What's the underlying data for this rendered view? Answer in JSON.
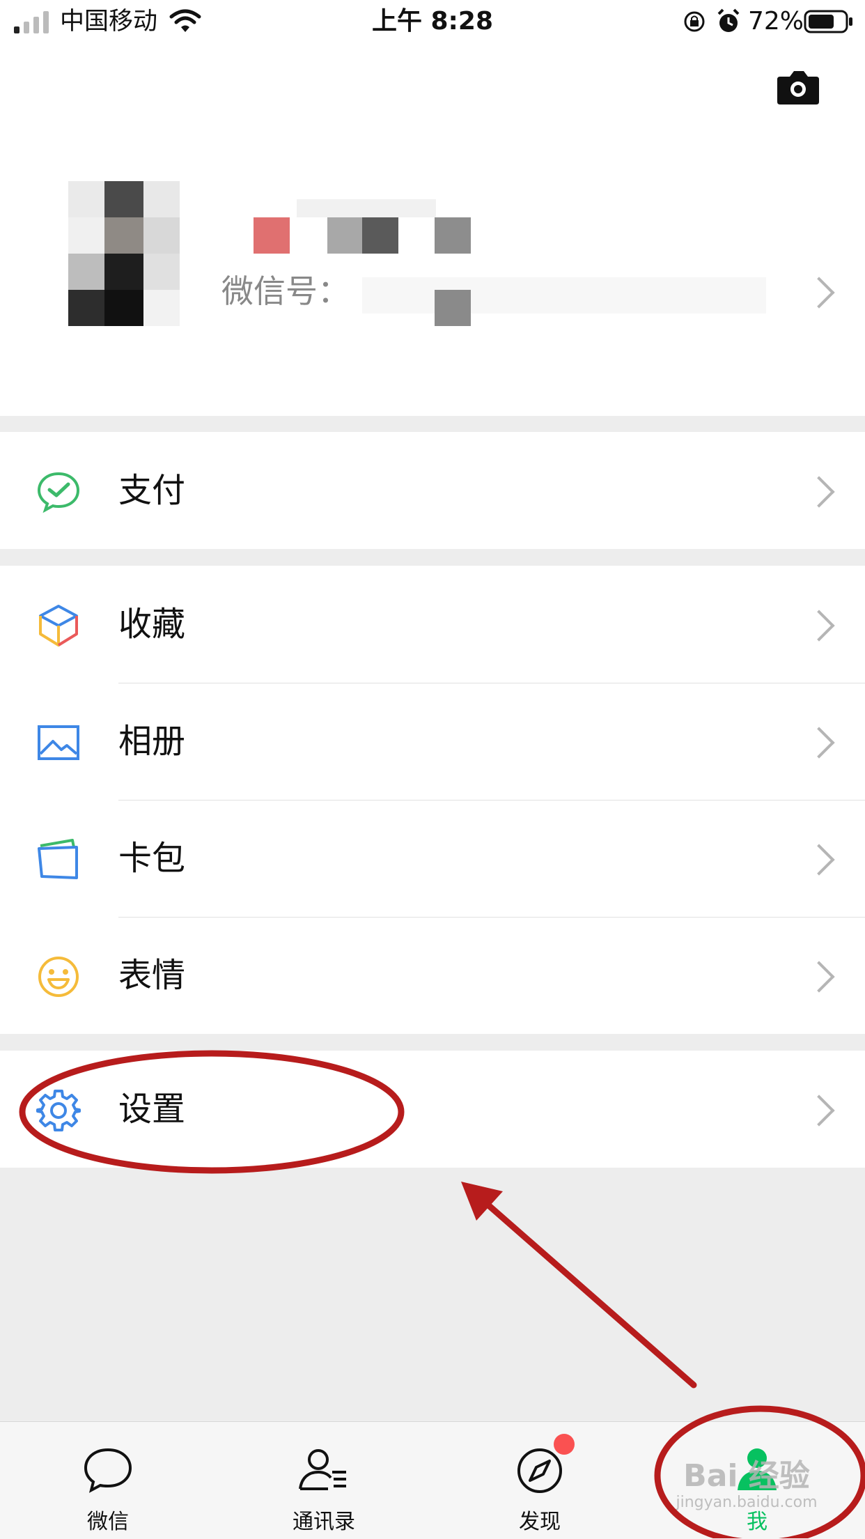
{
  "status_bar": {
    "carrier": "中国移动",
    "time": "上午 8:28",
    "battery": "72%"
  },
  "header": {
    "camera_icon": "camera-icon",
    "wechat_id_label": "微信号："
  },
  "menu": {
    "pay": "支付",
    "favorites": "收藏",
    "album": "相册",
    "cards": "卡包",
    "stickers": "表情",
    "settings": "设置"
  },
  "tabbar": {
    "tabs": [
      {
        "label": "微信",
        "icon": "chat-icon"
      },
      {
        "label": "通讯录",
        "icon": "contacts-icon"
      },
      {
        "label": "发现",
        "icon": "compass-icon"
      },
      {
        "label": "我",
        "icon": "me-icon"
      }
    ]
  },
  "watermark": {
    "text": "Bai 经验",
    "subtext": "jingyan.baidu.com"
  },
  "colors": {
    "accent": "#07c160",
    "annotation": "#b71c1c",
    "badge": "#fa5151"
  }
}
